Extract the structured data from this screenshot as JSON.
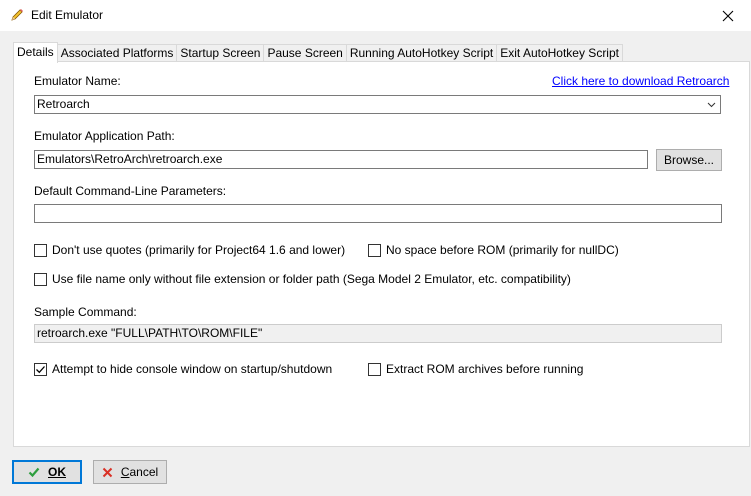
{
  "window": {
    "title": "Edit Emulator"
  },
  "tabs": [
    {
      "label": "Details"
    },
    {
      "label": "Associated Platforms"
    },
    {
      "label": "Startup Screen"
    },
    {
      "label": "Pause Screen"
    },
    {
      "label": "Running AutoHotkey Script"
    },
    {
      "label": "Exit AutoHotkey Script"
    }
  ],
  "details": {
    "emulator_name_label": "Emulator Name:",
    "download_link": "Click here to download Retroarch",
    "emulator_name_value": "Retroarch",
    "app_path_label": "Emulator Application Path:",
    "app_path_value": "Emulators\\RetroArch\\retroarch.exe",
    "browse_label": "Browse...",
    "params_label": "Default Command-Line Parameters:",
    "params_value": "",
    "checkboxes": [
      {
        "label": "Don't use quotes (primarily for Project64 1.6 and lower)",
        "checked": false
      },
      {
        "label": "No space before ROM (primarily for nullDC)",
        "checked": false
      },
      {
        "label": "Use file name only without file extension or folder path (Sega Model 2 Emulator, etc. compatibility)",
        "checked": false
      },
      {
        "label": "Attempt to hide console window on startup/shutdown",
        "checked": true
      },
      {
        "label": "Extract ROM archives before running",
        "checked": false
      }
    ],
    "sample_label": "Sample Command:",
    "sample_value": "retroarch.exe \"FULL\\PATH\\TO\\ROM\\FILE\""
  },
  "footer": {
    "ok_label": "OK",
    "cancel_label": "Cancel"
  },
  "colors": {
    "link": "#0000ff",
    "ok_icon": "#2e9e3e",
    "cancel_icon": "#d93025",
    "default_button_border": "#0078d7"
  },
  "icons": {
    "app": "pencil-icon",
    "close": "close-icon",
    "ok": "checkmark-icon",
    "cancel": "x-icon"
  }
}
